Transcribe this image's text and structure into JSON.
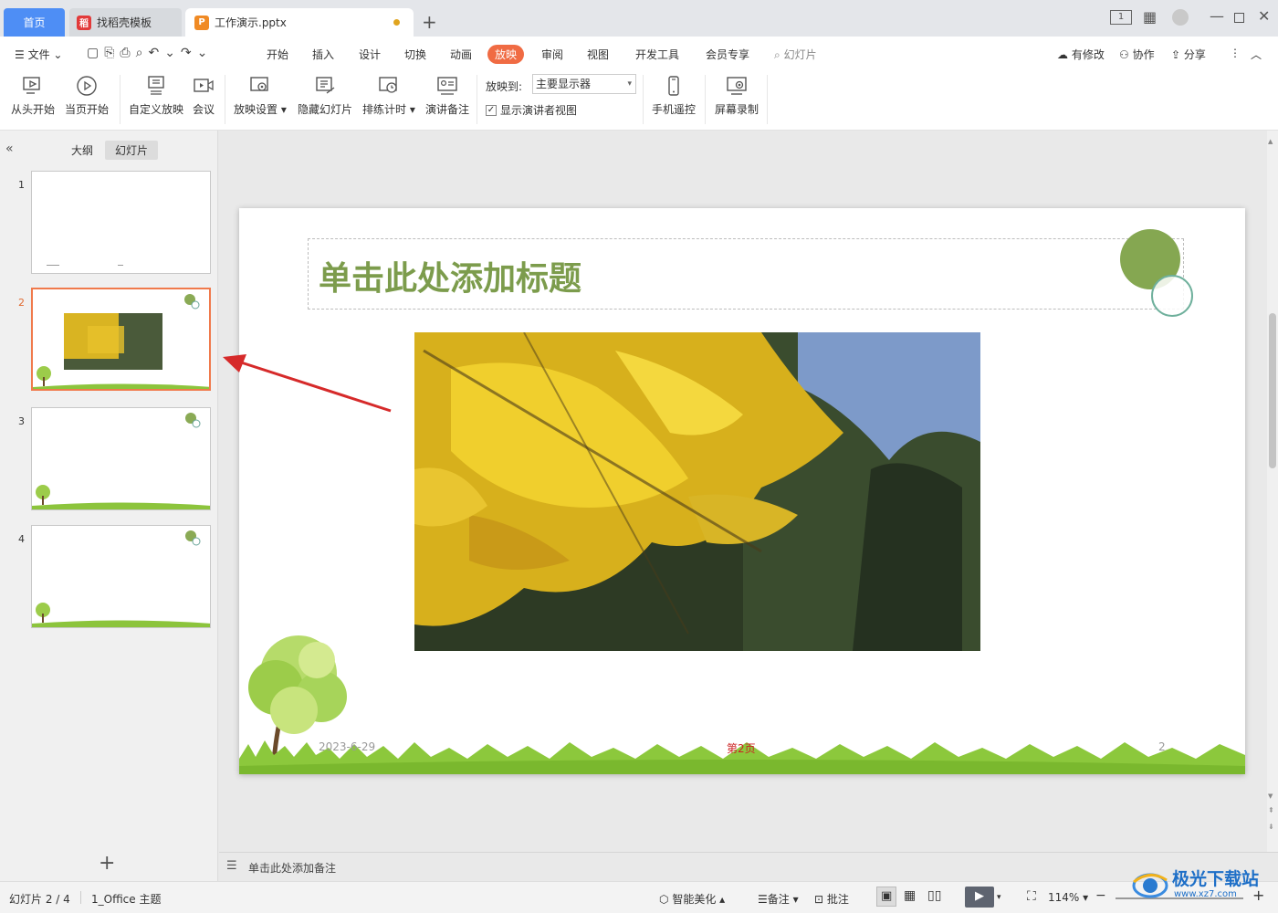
{
  "tabs": {
    "home": "首页",
    "templates": "找稻壳模板",
    "document": "工作演示.pptx"
  },
  "menu": {
    "file": "文件",
    "items": [
      "开始",
      "插入",
      "设计",
      "切换",
      "动画",
      "放映",
      "审阅",
      "视图",
      "开发工具",
      "会员专享"
    ],
    "search": "幻灯片",
    "has_changes": "有修改",
    "collaborate": "协作",
    "share": "分享"
  },
  "ribbon": {
    "from_start": "从头开始",
    "from_current": "当页开始",
    "custom_show": "自定义放映",
    "meeting": "会议",
    "show_settings": "放映设置",
    "hide_slide": "隐藏幻灯片",
    "rehearse": "排练计时",
    "speaker_notes": "演讲备注",
    "show_on_label": "放映到:",
    "show_on_value": "主要显示器",
    "presenter_view": "显示演讲者视图",
    "phone_remote": "手机遥控",
    "screen_record": "屏幕录制"
  },
  "panel": {
    "outline_tab": "大纲",
    "slides_tab": "幻灯片",
    "thumb_numbers": [
      "1",
      "2",
      "3",
      "4"
    ]
  },
  "slide": {
    "title": "单击此处添加标题",
    "date": "2023-6-29",
    "page_label": "第2页",
    "page_num": "2"
  },
  "notes_placeholder": "单击此处添加备注",
  "status": {
    "slide_info": "幻灯片 2 / 4",
    "theme": "1_Office 主题",
    "smart_beautify": "智能美化",
    "notes": "备注",
    "comments": "批注",
    "zoom": "114%"
  },
  "watermark": "极光下载站",
  "watermark_url": "www.xz7.com"
}
